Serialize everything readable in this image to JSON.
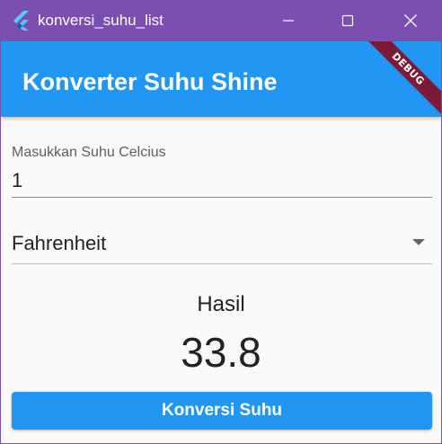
{
  "window": {
    "title": "konversi_suhu_list",
    "controls": [
      "minimize-icon",
      "maximize-icon",
      "close-icon"
    ]
  },
  "appbar": {
    "title": "Konverter Suhu Shine",
    "debug_banner": "DEBUG"
  },
  "form": {
    "celsius_label": "Masukkan Suhu Celcius",
    "celsius_value": "1",
    "unit_selected": "Fahrenheit"
  },
  "result": {
    "label": "Hasil",
    "value": "33.8"
  },
  "button": {
    "label": "Konversi Suhu"
  },
  "colors": {
    "titlebar": "#7b4fb0",
    "appbar": "#2196f3",
    "button": "#2196f3",
    "debug_banner": "#7b1a35",
    "background": "#fafafa"
  }
}
